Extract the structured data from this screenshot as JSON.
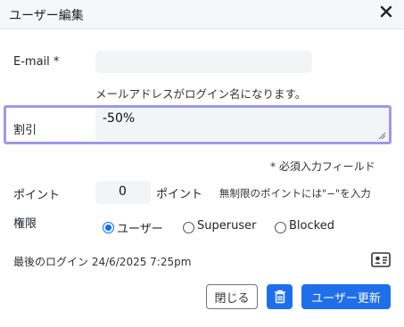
{
  "dialog": {
    "title": "ユーザー編集",
    "close_icon": "close-icon"
  },
  "email": {
    "label": "E-mail *",
    "value": "",
    "help": "メールアドレスがログイン名になります。"
  },
  "discount": {
    "label": "割引",
    "value": "-50%"
  },
  "required_note": "* 必須入力フィールド",
  "points": {
    "label": "ポイント",
    "value": "0",
    "unit": "ポイント",
    "help": "無制限のポイントには\"−\"を入力"
  },
  "role": {
    "label": "権限",
    "options": [
      {
        "label": "ユーザー",
        "selected": true
      },
      {
        "label": "Superuser",
        "selected": false
      },
      {
        "label": "Blocked",
        "selected": false
      }
    ]
  },
  "last_login": {
    "text": "最後のログイン 24/6/2025 7:25pm",
    "icon": "id-card-icon"
  },
  "footer": {
    "close_label": "閉じる",
    "delete_icon": "trash-icon",
    "update_label": "ユーザー更新"
  },
  "colors": {
    "accent": "#1f6feb",
    "focus_ring": "#9d98ec"
  }
}
